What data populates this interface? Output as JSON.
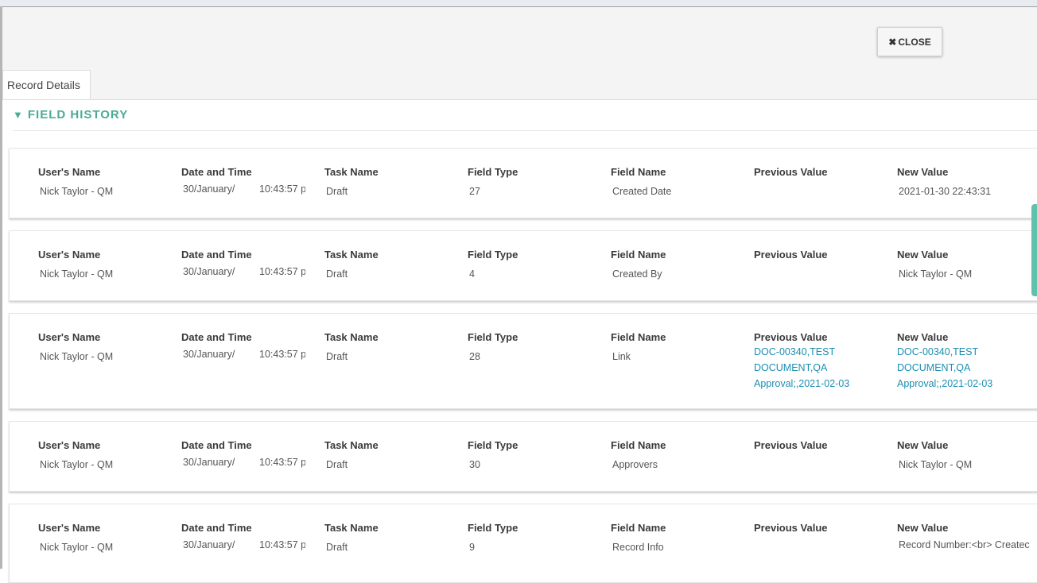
{
  "header": {
    "close_label": "CLOSE"
  },
  "tabs": [
    {
      "label": "Record Details"
    }
  ],
  "section": {
    "title": "FIELD HISTORY"
  },
  "columns": {
    "user": "User's Name",
    "datetime": "Date and Time",
    "task": "Task Name",
    "field_type": "Field Type",
    "field_name": "Field Name",
    "previous": "Previous Value",
    "new": "New Value"
  },
  "rows": [
    {
      "user": "Nick Taylor - QM",
      "date": "30/January/",
      "time": "10:43:57 p",
      "task": "Draft",
      "field_type": "27",
      "field_name": "Created Date",
      "previous": "",
      "new": "2021-01-30 22:43:31"
    },
    {
      "user": "Nick Taylor - QM",
      "date": "30/January/",
      "time": "10:43:57 p",
      "task": "Draft",
      "field_type": "4",
      "field_name": "Created By",
      "previous": "",
      "new": "Nick Taylor - QM"
    },
    {
      "user": "Nick Taylor - QM",
      "date": "30/January/",
      "time": "10:43:57 p",
      "task": "Draft",
      "field_type": "28",
      "field_name": "Link",
      "previous": "DOC-00340,TEST DOCUMENT,QA Approval;,2021-02-03",
      "new": "DOC-00340,TEST DOCUMENT,QA Approval;,2021-02-03"
    },
    {
      "user": "Nick Taylor - QM",
      "date": "30/January/",
      "time": "10:43:57 p",
      "task": "Draft",
      "field_type": "30",
      "field_name": "Approvers",
      "previous": "",
      "new": "Nick Taylor - QM"
    },
    {
      "user": "Nick Taylor - QM",
      "date": "30/January/",
      "time": "10:43:57 p",
      "task": "Draft",
      "field_type": "9",
      "field_name": "Record Info",
      "previous": "",
      "new": "Record Number:<br> Createc"
    }
  ],
  "colors": {
    "accent": "#4aab97",
    "link": "#1b8fb3"
  },
  "icons": {
    "close": "times-icon",
    "collapse": "triangle-down-icon"
  }
}
